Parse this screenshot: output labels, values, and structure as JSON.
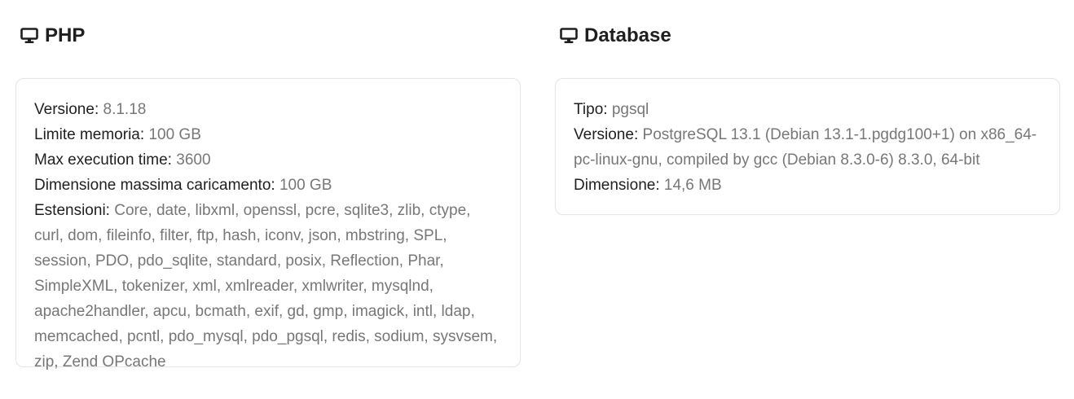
{
  "php": {
    "title": "PHP",
    "icon": "monitor-icon",
    "fields": {
      "version_label": "Versione:",
      "version_value": "8.1.18",
      "memory_label": "Limite memoria:",
      "memory_value": "100 GB",
      "exec_label": "Max execution time:",
      "exec_value": "3600",
      "upload_label": "Dimensione massima caricamento:",
      "upload_value": "100 GB",
      "ext_label": "Estensioni:",
      "ext_value": "Core, date, libxml, openssl, pcre, sqlite3, zlib, ctype, curl, dom, fileinfo, filter, ftp, hash, iconv, json, mbstring, SPL, session, PDO, pdo_sqlite, standard, posix, Reflection, Phar, SimpleXML, tokenizer, xml, xmlreader, xmlwriter, mysqlnd, apache2handler, apcu, bcmath, exif, gd, gmp, imagick, intl, ldap, memcached, pcntl, pdo_mysql, pdo_pgsql, redis, sodium, sysvsem, zip, Zend OPcache"
    }
  },
  "database": {
    "title": "Database",
    "icon": "monitor-icon",
    "fields": {
      "type_label": "Tipo:",
      "type_value": "pgsql",
      "version_label": "Versione:",
      "version_value": "PostgreSQL 13.1 (Debian 13.1-1.pgdg100+1) on x86_64-pc-linux-gnu, compiled by gcc (Debian 8.3.0-6) 8.3.0, 64-bit",
      "size_label": "Dimensione:",
      "size_value": "14,6 MB"
    }
  },
  "colors": {
    "label": "#1f1f1f",
    "value": "#777777",
    "border": "#e6e6e6"
  }
}
